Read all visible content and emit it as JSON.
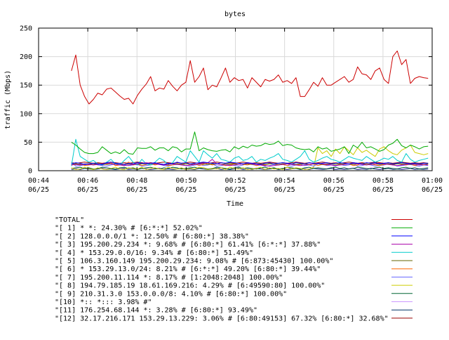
{
  "chart_data": {
    "type": "line",
    "title": "bytes",
    "xlabel": "Time",
    "ylabel": "traffic (Mbps)",
    "ylim": [
      0,
      250
    ],
    "y_ticks": [
      0,
      50,
      100,
      150,
      200,
      250
    ],
    "x_range": [
      "00:44",
      "01:00"
    ],
    "x_ticks": [
      {
        "time": "00:44",
        "date": "06/25"
      },
      {
        "time": "00:46",
        "date": "06/25"
      },
      {
        "time": "00:48",
        "date": "06/25"
      },
      {
        "time": "00:50",
        "date": "06/25"
      },
      {
        "time": "00:52",
        "date": "06/25"
      },
      {
        "time": "00:54",
        "date": "06/25"
      },
      {
        "time": "00:56",
        "date": "06/25"
      },
      {
        "time": "00:58",
        "date": "06/25"
      },
      {
        "time": "01:00",
        "date": "06/25"
      }
    ],
    "x_sample_start": "00:45:20",
    "x_sample_end": "00:59:50",
    "grid": true,
    "legend_position": "bottom",
    "series": [
      {
        "name": "\"TOTAL\"",
        "color": "#cc0000",
        "values": [
          175,
          203,
          150,
          130,
          117,
          125,
          136,
          133,
          143,
          145,
          138,
          131,
          125,
          127,
          117,
          132,
          143,
          152,
          165,
          140,
          145,
          143,
          158,
          148,
          140,
          150,
          155,
          193,
          155,
          165,
          180,
          142,
          150,
          147,
          163,
          180,
          155,
          163,
          158,
          160,
          145,
          163,
          155,
          147,
          160,
          157,
          160,
          168,
          155,
          158,
          153,
          163,
          130,
          130,
          142,
          155,
          148,
          163,
          150,
          150,
          155,
          160,
          165,
          155,
          160,
          182,
          170,
          168,
          160,
          175,
          180,
          160,
          153,
          200,
          210,
          186,
          195,
          153,
          162,
          165,
          163,
          162
        ]
      },
      {
        "name": "\"[ 1] * *: 24.30% # [6:*:*] 52.02%\"",
        "color": "#00aa00",
        "values": [
          50,
          45,
          38,
          32,
          30,
          30,
          32,
          42,
          36,
          30,
          33,
          30,
          37,
          30,
          29,
          40,
          39,
          39,
          42,
          36,
          40,
          40,
          35,
          42,
          40,
          33,
          38,
          38,
          68,
          35,
          40,
          37,
          35,
          34,
          36,
          37,
          33,
          42,
          38,
          43,
          40,
          45,
          43,
          44,
          48,
          46,
          47,
          52,
          44,
          46,
          45,
          40,
          38,
          37,
          38,
          33,
          42,
          38,
          40,
          34,
          36,
          38,
          42,
          30,
          45,
          40,
          50,
          40,
          42,
          38,
          34,
          37,
          45,
          48,
          55,
          44,
          40,
          45,
          42,
          38,
          42,
          43
        ]
      },
      {
        "name": "\"[ 2] 128.0.0.0/1 *: 12.50% # [6:80:*] 38.38%\"",
        "color": "#0000ff",
        "values": [
          12,
          14,
          13,
          11,
          12,
          13,
          12,
          11,
          14,
          15,
          13,
          12,
          11,
          13,
          12,
          14,
          13,
          12,
          13,
          14,
          12,
          11,
          13,
          12,
          15,
          13,
          14,
          12,
          13,
          14,
          15,
          14,
          13,
          12,
          14,
          13,
          15,
          14,
          13,
          12,
          14,
          13,
          12,
          11,
          13,
          14,
          12,
          13,
          14,
          13,
          12,
          14,
          13,
          12,
          14,
          13,
          12,
          13,
          14,
          12,
          13,
          14,
          13,
          12,
          14,
          13,
          12,
          14,
          13,
          14,
          12,
          13,
          14,
          12,
          13,
          14,
          13,
          12,
          13,
          12,
          13,
          13
        ]
      },
      {
        "name": "\"[ 3] 195.200.29.234 *: 9.68% # [6:80:*] 61.41% [6:*:*] 37.88%\"",
        "color": "#aa00aa",
        "values": [
          10,
          11,
          10,
          12,
          11,
          10,
          11,
          12,
          13,
          12,
          11,
          10,
          9,
          10,
          11,
          12,
          13,
          14,
          13,
          12,
          11,
          10,
          11,
          12,
          11,
          10,
          9,
          10,
          11,
          12,
          13,
          14,
          20,
          12,
          11,
          10,
          9,
          10,
          11,
          12,
          13,
          12,
          11,
          10,
          9,
          8,
          9,
          10,
          11,
          12,
          11,
          10,
          9,
          10,
          11,
          12,
          13,
          12,
          11,
          10,
          9,
          10,
          11,
          12,
          13,
          12,
          11,
          10,
          11,
          12,
          13,
          12,
          11,
          10,
          9,
          10,
          11,
          12,
          11,
          10,
          11,
          10
        ]
      },
      {
        "name": "\"[ 4] * 153.29.0.0/16: 9.34% # [6:80:*] 51.49%\"",
        "color": "#00cccc",
        "values": [
          8,
          55,
          25,
          20,
          15,
          18,
          12,
          10,
          15,
          20,
          12,
          10,
          18,
          25,
          15,
          10,
          20,
          12,
          10,
          15,
          22,
          18,
          10,
          14,
          25,
          20,
          15,
          35,
          25,
          15,
          35,
          28,
          22,
          30,
          20,
          18,
          15,
          22,
          25,
          18,
          20,
          25,
          15,
          20,
          18,
          22,
          25,
          30,
          20,
          18,
          15,
          20,
          25,
          35,
          20,
          15,
          18,
          22,
          25,
          20,
          18,
          15,
          20,
          25,
          22,
          20,
          18,
          25,
          20,
          15,
          18,
          22,
          20,
          25,
          18,
          15,
          30,
          20,
          15,
          18,
          20,
          22
        ]
      },
      {
        "name": "\"[ 5] 106.3.160.149 195.200.29.234: 9.08% # [6:873:45430] 100.00%\"",
        "color": "#666600",
        "values": [
          12,
          12,
          11,
          12,
          12,
          11,
          12,
          12,
          11,
          12,
          12,
          12,
          11,
          12,
          12,
          11,
          12,
          12,
          11,
          12,
          12,
          11,
          12,
          12,
          12,
          11,
          12,
          12,
          11,
          12,
          12,
          11,
          12,
          12,
          11,
          12,
          12,
          12,
          11,
          12,
          12,
          11,
          12,
          12,
          11,
          12,
          12,
          11,
          12,
          12,
          12,
          11,
          12,
          12,
          11,
          12,
          12,
          11,
          12,
          12,
          11,
          12,
          12,
          12,
          11,
          12,
          12,
          11,
          12,
          12,
          11,
          12,
          12,
          11,
          12,
          12,
          12,
          11,
          12,
          12,
          11,
          12
        ]
      },
      {
        "name": "\"[ 6] * 153.29.13.0/24: 8.21% # [6:*:*] 49.20% [6:80:*] 39.44%\"",
        "color": "#ff6600",
        "values": [
          10,
          11,
          12,
          9,
          10,
          11,
          13,
          10,
          12,
          14,
          9,
          10,
          11,
          15,
          10,
          12,
          9,
          11,
          13,
          10,
          12,
          11,
          9,
          10,
          12,
          11,
          14,
          10,
          12,
          9,
          11,
          13,
          10,
          12,
          11,
          9,
          10,
          12,
          14,
          11,
          10,
          12,
          9,
          11,
          10,
          13,
          12,
          10,
          11,
          9,
          12,
          10,
          11,
          13,
          10,
          12,
          9,
          11,
          10,
          12,
          14,
          10,
          11,
          12,
          9,
          10,
          13,
          11,
          12,
          10,
          9,
          11,
          12,
          10,
          13,
          11,
          10,
          12,
          9,
          11,
          10,
          12
        ]
      },
      {
        "name": "\"[ 7] 195.200.11.114 *: 8.17% # [1:2048:2048] 100.00%\"",
        "color": "#6666ff",
        "values": [
          15,
          8,
          9,
          10,
          12,
          13,
          10,
          9,
          8,
          10,
          12,
          13,
          10,
          9,
          10,
          11,
          8,
          9,
          10,
          12,
          11,
          9,
          8,
          10,
          11,
          12,
          9,
          8,
          10,
          11,
          9,
          10,
          12,
          8,
          9,
          10,
          11,
          9,
          8,
          10,
          12,
          11,
          9,
          10,
          8,
          9,
          11,
          10,
          12,
          9,
          8,
          10,
          11,
          9,
          10,
          8,
          12,
          11,
          9,
          10,
          8,
          11,
          9,
          10,
          12,
          8,
          9,
          11,
          10,
          8,
          9,
          10,
          12,
          11,
          8,
          9,
          10,
          11,
          9,
          8,
          10,
          9
        ]
      },
      {
        "name": "\"[ 8] 194.79.185.19 18.61.169.216: 4.29% # [6:49590:80] 100.00%\"",
        "color": "#cccc00",
        "values": [
          5,
          2,
          3,
          6,
          4,
          2,
          5,
          3,
          2,
          4,
          6,
          3,
          2,
          5,
          4,
          3,
          6,
          2,
          4,
          5,
          3,
          2,
          6,
          4,
          3,
          5,
          2,
          4,
          3,
          6,
          5,
          2,
          4,
          3,
          5,
          2,
          6,
          4,
          3,
          5,
          2,
          3,
          4,
          6,
          2,
          5,
          3,
          4,
          2,
          6,
          3,
          5,
          4,
          2,
          3,
          6,
          40,
          30,
          35,
          25,
          38,
          30,
          42,
          35,
          28,
          40,
          32,
          36,
          30,
          25,
          38,
          42,
          35,
          30,
          28,
          36,
          40,
          45,
          32,
          30,
          28,
          30
        ]
      },
      {
        "name": "\"[ 9] 210.31.3.0 153.0.0.0/8: 4.10% # [6:80:*] 100.00%\"",
        "color": "#006633",
        "values": [
          4,
          5,
          6,
          4,
          5,
          3,
          4,
          6,
          5,
          4,
          3,
          5,
          6,
          4,
          5,
          3,
          4,
          5,
          6,
          4,
          3,
          5,
          4,
          6,
          5,
          3,
          4,
          5,
          6,
          4,
          5,
          3,
          4,
          6,
          5,
          4,
          3,
          5,
          6,
          4,
          5,
          4,
          3,
          5,
          6,
          4,
          5,
          3,
          4,
          6,
          5,
          4,
          3,
          5,
          6,
          4,
          5,
          4,
          3,
          5,
          6,
          4,
          5,
          3,
          4,
          6,
          5,
          4,
          3,
          5,
          6,
          4,
          5,
          4,
          3,
          5,
          6,
          4,
          5,
          3,
          4,
          5
        ]
      },
      {
        "name": "\"[10] *:: *::: 3.98% #\"",
        "color": "#cc99ff",
        "values": [
          3,
          4,
          3,
          5,
          4,
          3,
          4,
          5,
          3,
          4,
          3,
          4,
          5,
          3,
          4,
          3,
          5,
          4,
          3,
          4,
          5,
          3,
          4,
          3,
          4,
          5,
          3,
          4,
          3,
          5,
          4,
          3,
          4,
          5,
          3,
          4,
          3,
          4,
          5,
          3,
          4,
          3,
          5,
          4,
          3,
          4,
          5,
          3,
          4,
          3,
          4,
          5,
          3,
          4,
          3,
          5,
          4,
          3,
          4,
          5,
          3,
          4,
          3,
          4,
          5,
          3,
          4,
          3,
          5,
          4,
          3,
          4,
          5,
          3,
          4,
          3,
          4,
          5,
          3,
          4,
          3,
          4
        ]
      },
      {
        "name": "\"[11] 176.254.68.144 *: 3.28% # [6:80:*] 93.49%\"",
        "color": "#003366",
        "values": [
          2,
          3,
          2,
          4,
          3,
          2,
          3,
          4,
          2,
          3,
          2,
          3,
          4,
          2,
          3,
          2,
          4,
          3,
          2,
          3,
          4,
          2,
          3,
          2,
          3,
          4,
          2,
          3,
          2,
          4,
          3,
          2,
          3,
          4,
          2,
          3,
          2,
          3,
          4,
          2,
          3,
          2,
          4,
          3,
          2,
          3,
          4,
          2,
          3,
          2,
          3,
          4,
          2,
          3,
          2,
          4,
          3,
          2,
          3,
          4,
          2,
          3,
          2,
          3,
          4,
          2,
          3,
          2,
          4,
          3,
          2,
          3,
          4,
          2,
          3,
          2,
          3,
          4,
          2,
          3,
          2,
          3
        ]
      },
      {
        "name": "\"[12] 32.17.216.171 153.29.13.229: 3.06% # [6:80:49153] 67.32% [6:80:*] 32.68%\"",
        "color": "#990000",
        "values": [
          14,
          13,
          14,
          15,
          14,
          13,
          14,
          13,
          14,
          15,
          14,
          13,
          14,
          13,
          14,
          15,
          14,
          13,
          14,
          13,
          14,
          15,
          14,
          13,
          14,
          13,
          14,
          15,
          14,
          13,
          14,
          13,
          14,
          15,
          14,
          13,
          14,
          13,
          14,
          15,
          14,
          13,
          14,
          13,
          14,
          15,
          14,
          13,
          14,
          13,
          14,
          15,
          14,
          13,
          14,
          13,
          14,
          15,
          14,
          13,
          14,
          13,
          14,
          15,
          14,
          13,
          14,
          13,
          14,
          15,
          14,
          13,
          14,
          13,
          14,
          15,
          14,
          13,
          14,
          13,
          14,
          13
        ]
      }
    ]
  }
}
